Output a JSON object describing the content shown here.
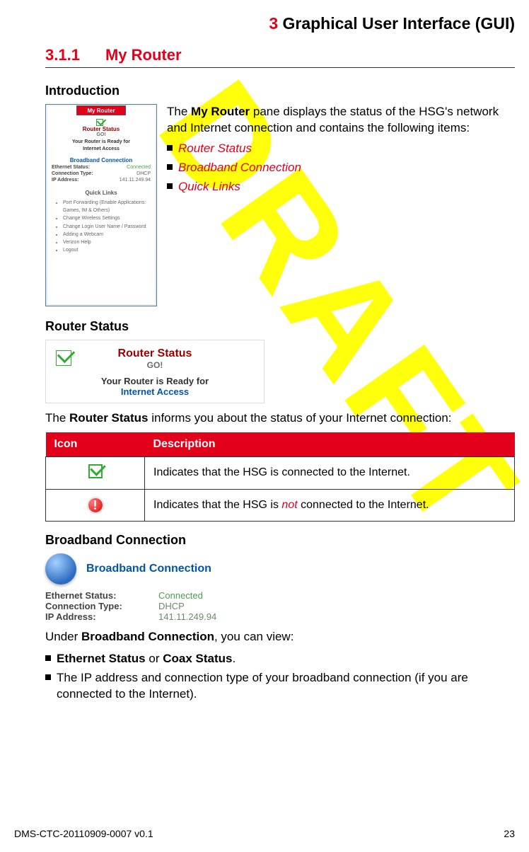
{
  "header": {
    "chapter_num": "3",
    "chapter_title": "Graphical User Interface (GUI)"
  },
  "section": {
    "num": "3.1.1",
    "title": "My Router"
  },
  "intro": {
    "heading": "Introduction",
    "text_lead": "The ",
    "text_bold": "My Router",
    "text_tail": " pane displays the status of the HSG's network and Internet connection and contains the following items:",
    "bullets": [
      "Router Status",
      "Broadband Connection",
      "Quick Links"
    ]
  },
  "panel": {
    "tab": "My Router",
    "rs_title": "Router Status",
    "rs_go": "GO!",
    "rs_ready1": "Your Router is Ready for",
    "rs_ready2": "Internet Access",
    "bc_title": "Broadband Connection",
    "bc_rows": [
      {
        "l": "Ethernet Status:",
        "v": "Connected"
      },
      {
        "l": "Connection Type:",
        "v": "DHCP"
      },
      {
        "l": "IP Address:",
        "v": "141.11.249.94"
      }
    ],
    "ql_title": "Quick Links",
    "ql_items": [
      "Port Forwarding (Enable Applications: Games, IM & Others)",
      "Change Wireless Settings",
      "Change Login User Name / Password",
      "Adding a Webcam",
      "Verizon Help",
      "Logout"
    ]
  },
  "router_status": {
    "heading": "Router Status",
    "box_title": "Router Status",
    "box_go": "GO!",
    "box_ready1": "Your Router is Ready for",
    "box_ready2": "Internet Access",
    "para_lead": "The ",
    "para_bold": "Router Status",
    "para_tail": " informs you about the status of your Internet connection:",
    "table": {
      "col1": "Icon",
      "col2": "Description",
      "row1": "Indicates that the HSG is connected to the Internet.",
      "row2_lead": "Indicates that the HSG is ",
      "row2_em": "not",
      "row2_tail": " connected to the Internet."
    }
  },
  "broadband": {
    "heading": "Broadband Connection",
    "box_title": "Broadband Connection",
    "rows": [
      {
        "l": "Ethernet Status:",
        "v": "Connected"
      },
      {
        "l": "Connection Type:",
        "v": "DHCP"
      },
      {
        "l": "IP Address:",
        "v": "141.11.249.94"
      }
    ],
    "para_lead": "Under ",
    "para_bold": "Broadband Connection",
    "para_tail": ", you can view:",
    "b1_a": "Ethernet Status",
    "b1_b": " or ",
    "b1_c": "Coax Status",
    "b1_d": ".",
    "b2": "The IP address and connection type of your broadband connection (if you are connected to the Internet)."
  },
  "footer": {
    "doc": "DMS-CTC-20110909-0007 v0.1",
    "page": "23"
  },
  "watermark": "DRAFT"
}
